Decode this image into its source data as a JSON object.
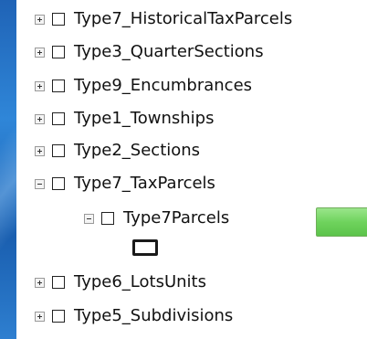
{
  "layers": [
    {
      "label": "Type7_HistoricalTaxParcels",
      "expanded": false
    },
    {
      "label": "Type3_QuarterSections",
      "expanded": false
    },
    {
      "label": "Type9_Encumbrances",
      "expanded": false
    },
    {
      "label": "Type1_Townships",
      "expanded": false
    },
    {
      "label": "Type2_Sections",
      "expanded": false
    },
    {
      "label": "Type7_TaxParcels",
      "expanded": true
    },
    {
      "label": "Type7Parcels",
      "expanded": true
    },
    {
      "label": "Type6_LotsUnits",
      "expanded": false
    },
    {
      "label": "Type5_Subdivisions",
      "expanded": false
    }
  ],
  "colors": {
    "symbol_fill": "#ffffff",
    "symbol_outline": "#1a1a1a",
    "green_highlight": "#6fd35d"
  }
}
